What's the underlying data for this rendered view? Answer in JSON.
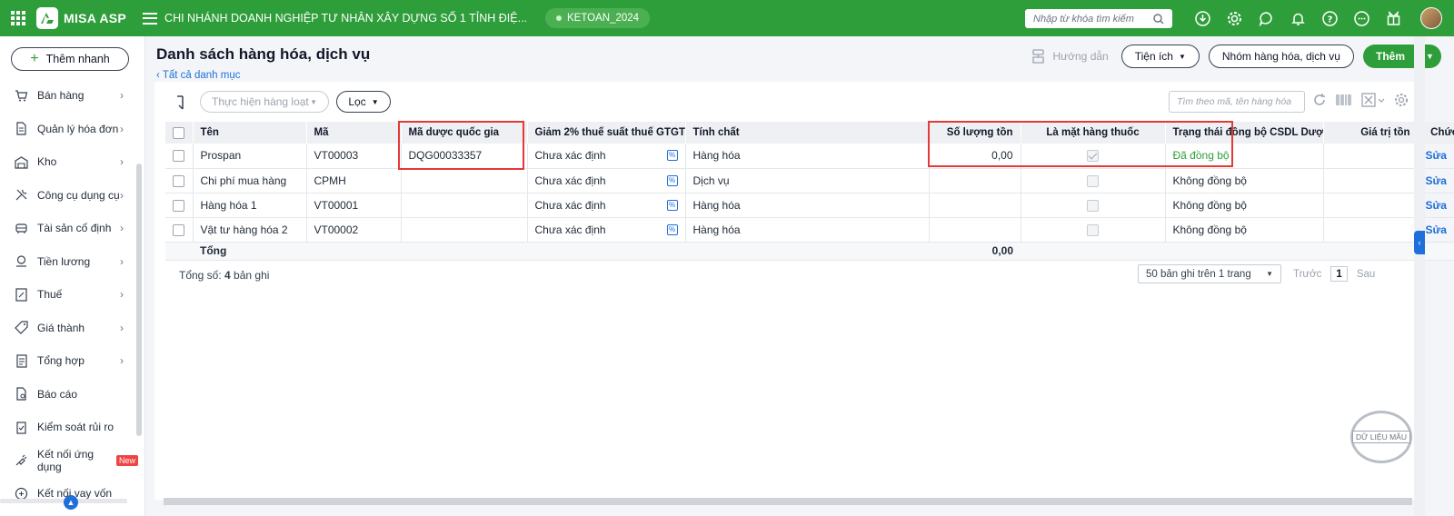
{
  "topbar": {
    "logo": "MISA ASP",
    "company": "CHI NHÁNH DOANH NGHIỆP TƯ NHÂN XÂY DỰNG SỐ 1 TỈNH ĐIỆ...",
    "year": "KETOAN_2024",
    "search_placeholder": "Nhập từ khóa tìm kiếm",
    "icons": [
      "download-icon",
      "gear-icon",
      "chat-icon",
      "bell-icon",
      "help-icon",
      "more-icon",
      "gift-icon"
    ]
  },
  "sidebar": {
    "quick_add": "Thêm nhanh",
    "items": [
      {
        "label": "Bán hàng",
        "icon": "cart-icon",
        "chev": true
      },
      {
        "label": "Quản lý hóa đơn",
        "icon": "invoice-icon",
        "chev": true
      },
      {
        "label": "Kho",
        "icon": "warehouse-icon",
        "chev": true
      },
      {
        "label": "Công cụ dụng cụ",
        "icon": "tools-icon",
        "chev": true
      },
      {
        "label": "Tài sản cố định",
        "icon": "asset-icon",
        "chev": true
      },
      {
        "label": "Tiền lương",
        "icon": "salary-icon",
        "chev": true
      },
      {
        "label": "Thuế",
        "icon": "tax-icon",
        "chev": true
      },
      {
        "label": "Giá thành",
        "icon": "price-tag-icon",
        "chev": true
      },
      {
        "label": "Tổng hợp",
        "icon": "summary-icon",
        "chev": true
      },
      {
        "label": "Báo cáo",
        "icon": "report-icon",
        "chev": false
      },
      {
        "label": "Kiểm soát rủi ro",
        "icon": "risk-icon",
        "chev": false
      },
      {
        "label": "Kết nối ứng dụng",
        "icon": "plug-icon",
        "chev": false,
        "badge": "New"
      },
      {
        "label": "Kết nối vay vốn",
        "icon": "loan-icon",
        "chev": false
      }
    ]
  },
  "header": {
    "title": "Danh sách hàng hóa, dịch vụ",
    "breadcrumb": "Tất cả danh mục",
    "guide": "Hướng dẫn",
    "utilities": "Tiện ích",
    "group_button": "Nhóm hàng hóa, dịch vụ",
    "add_button": "Thêm"
  },
  "toolbar": {
    "bulk_action": "Thực hiện hàng loạt",
    "filter": "Lọc",
    "search_placeholder": "Tìm theo mã, tên hàng hóa"
  },
  "table": {
    "columns": [
      "Tên",
      "Mã",
      "Mã dược quốc gia",
      "Giảm 2% thuế suất thuế GTGT",
      "Tính chất",
      "Số lượng tồn",
      "Là mặt hàng thuốc",
      "Trạng thái đồng bộ CSDL Dược",
      "Giá trị tồn",
      "Chức năng"
    ],
    "rows": [
      {
        "name": "Prospan",
        "code": "VT00003",
        "drug_code": "DQG00033357",
        "vat": "Chưa xác định",
        "nature": "Hàng hóa",
        "qty": "0,00",
        "is_drug": true,
        "sync": "Đã đồng bộ",
        "sync_ok": true,
        "value": "",
        "action": "Sửa"
      },
      {
        "name": "Chi phí mua hàng",
        "code": "CPMH",
        "drug_code": "",
        "vat": "Chưa xác định",
        "nature": "Dịch vụ",
        "qty": "",
        "is_drug": false,
        "sync": "Không đồng bộ",
        "sync_ok": false,
        "value": "",
        "action": "Sửa"
      },
      {
        "name": "Hàng hóa 1",
        "code": "VT00001",
        "drug_code": "",
        "vat": "Chưa xác định",
        "nature": "Hàng hóa",
        "qty": "",
        "is_drug": false,
        "sync": "Không đồng bộ",
        "sync_ok": false,
        "value": "",
        "action": "Sửa"
      },
      {
        "name": "Vật tư hàng hóa 2",
        "code": "VT00002",
        "drug_code": "",
        "vat": "Chưa xác định",
        "nature": "Hàng hóa",
        "qty": "",
        "is_drug": false,
        "sync": "Không đồng bộ",
        "sync_ok": false,
        "value": "",
        "action": "Sửa"
      }
    ],
    "total_label": "Tổng",
    "total_qty": "0,00"
  },
  "footer": {
    "count_prefix": "Tổng số: ",
    "count": "4",
    "count_suffix": " bản ghi",
    "page_size": "50 bản ghi trên 1 trang",
    "prev": "Trước",
    "page": "1",
    "next": "Sau"
  },
  "watermark": "DỮ LIỆU MẪU",
  "colors": {
    "brand": "#2e9e3a",
    "link": "#1e6fd9",
    "highlight": "#e53935"
  }
}
